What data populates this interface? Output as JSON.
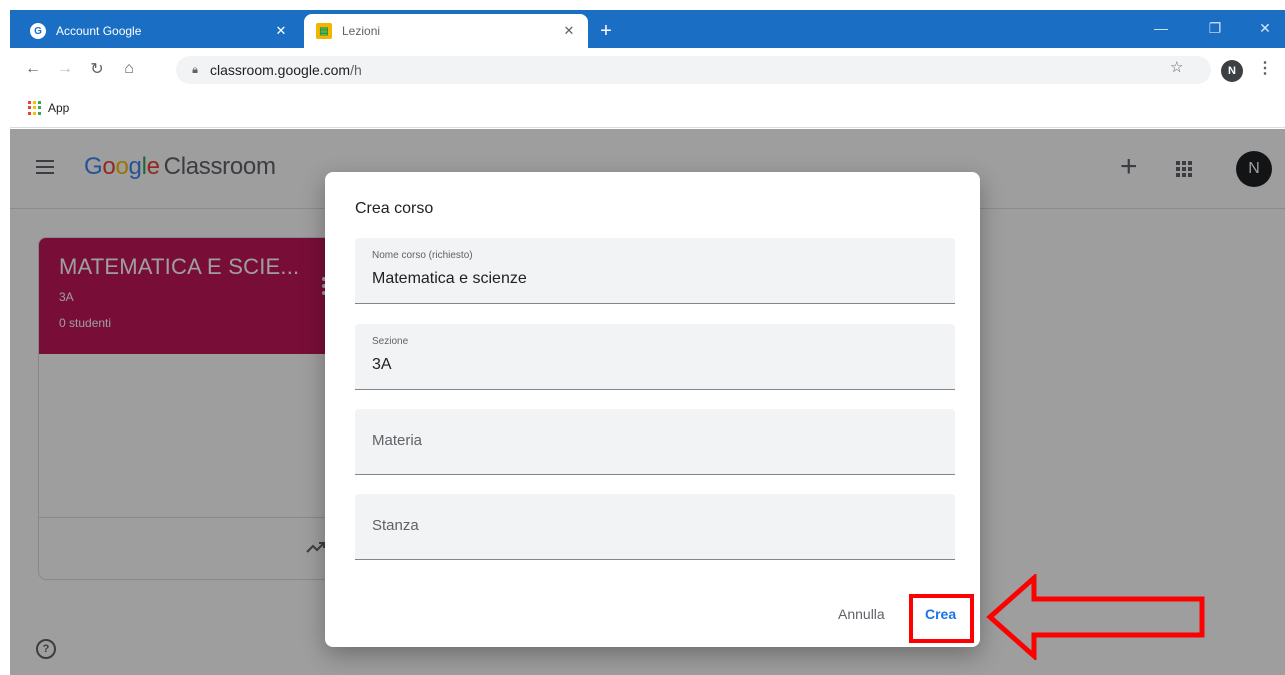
{
  "browser": {
    "tabs": [
      {
        "title": "Account Google",
        "favicon": "google-account-icon",
        "active": false
      },
      {
        "title": "Lezioni",
        "favicon": "classroom-icon",
        "active": true
      }
    ],
    "address": {
      "domain": "classroom.google.com",
      "path": "/h"
    },
    "profile_initial": "N",
    "bookmarks": [
      {
        "label": "App",
        "icon": "apps-grid-icon"
      }
    ],
    "tabstrip_color": "#1a6fc4"
  },
  "app": {
    "logo": {
      "g1": "G",
      "g2": "o",
      "g3": "o",
      "g4": "g",
      "g5": "l",
      "g6": "e",
      "product": "Classroom"
    },
    "avatar_initial": "N"
  },
  "course_card": {
    "title": "MATEMATICA E SCIE...",
    "section": "3A",
    "students": "0 studenti",
    "color": "#c2185b"
  },
  "dialog": {
    "title": "Crea corso",
    "fields": [
      {
        "label": "Nome corso (richiesto)",
        "value": "Matematica e scienze"
      },
      {
        "label": "Sezione",
        "value": "3A"
      },
      {
        "placeholder": "Materia"
      },
      {
        "placeholder": "Stanza"
      }
    ],
    "cancel_label": "Annulla",
    "create_label": "Crea"
  },
  "annotation": {
    "color": "#ff0000"
  }
}
